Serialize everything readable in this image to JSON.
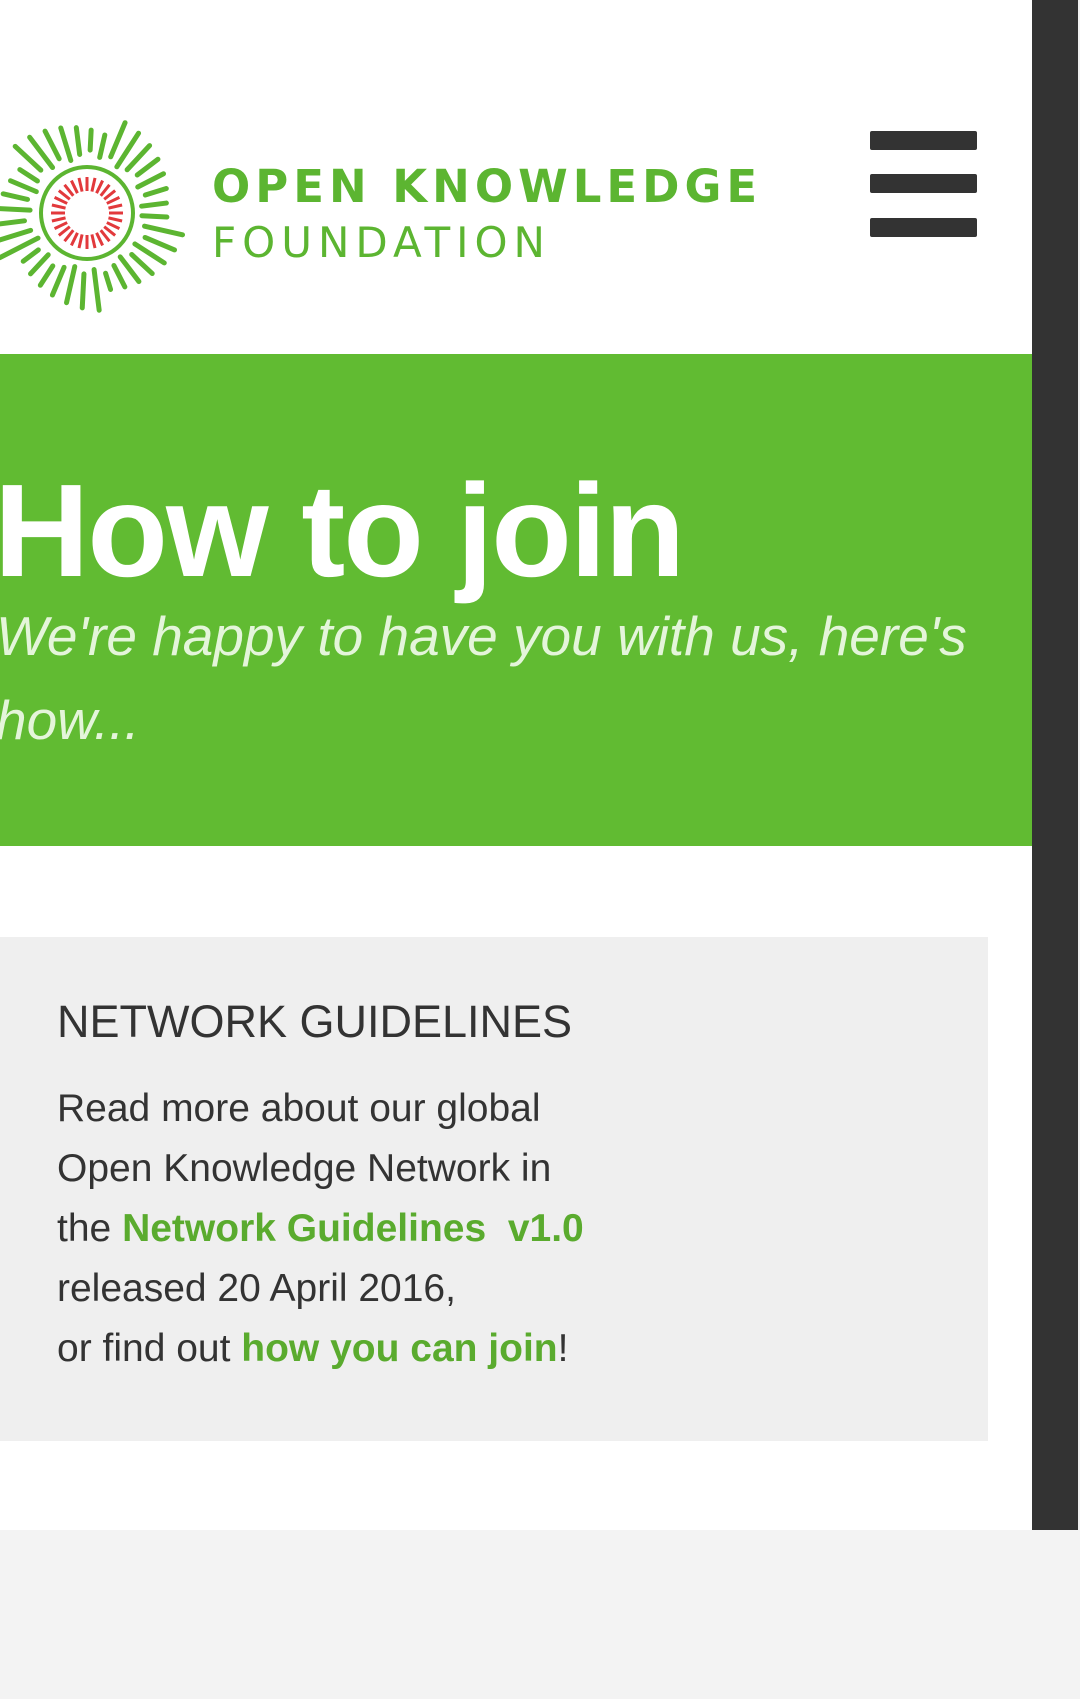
{
  "header": {
    "logo": {
      "line1": "OPEN KNOWLEDGE",
      "line2": "FOUNDATION"
    },
    "menu_icon": "hamburger-menu-icon"
  },
  "hero": {
    "title": "How to join",
    "subtitle": "We're happy to have you with us, here's how..."
  },
  "card": {
    "heading": "NETWORK GUIDELINES",
    "line1": "Read more about our global",
    "line2": "Open Knowledge Network in",
    "line3_prefix": "the ",
    "guidelines_link": "Network Guidelines  v1.0",
    "line4": "released 20 April 2016,",
    "line5_prefix": "or find out ",
    "join_link": "how you can join",
    "line5_suffix": "!"
  },
  "colors": {
    "brand_green": "#61bb32",
    "link_green": "#5aab2e",
    "logo_green": "#5cb531",
    "logo_red": "#e2393c",
    "text_dark": "#333333",
    "card_bg": "#efefef"
  }
}
